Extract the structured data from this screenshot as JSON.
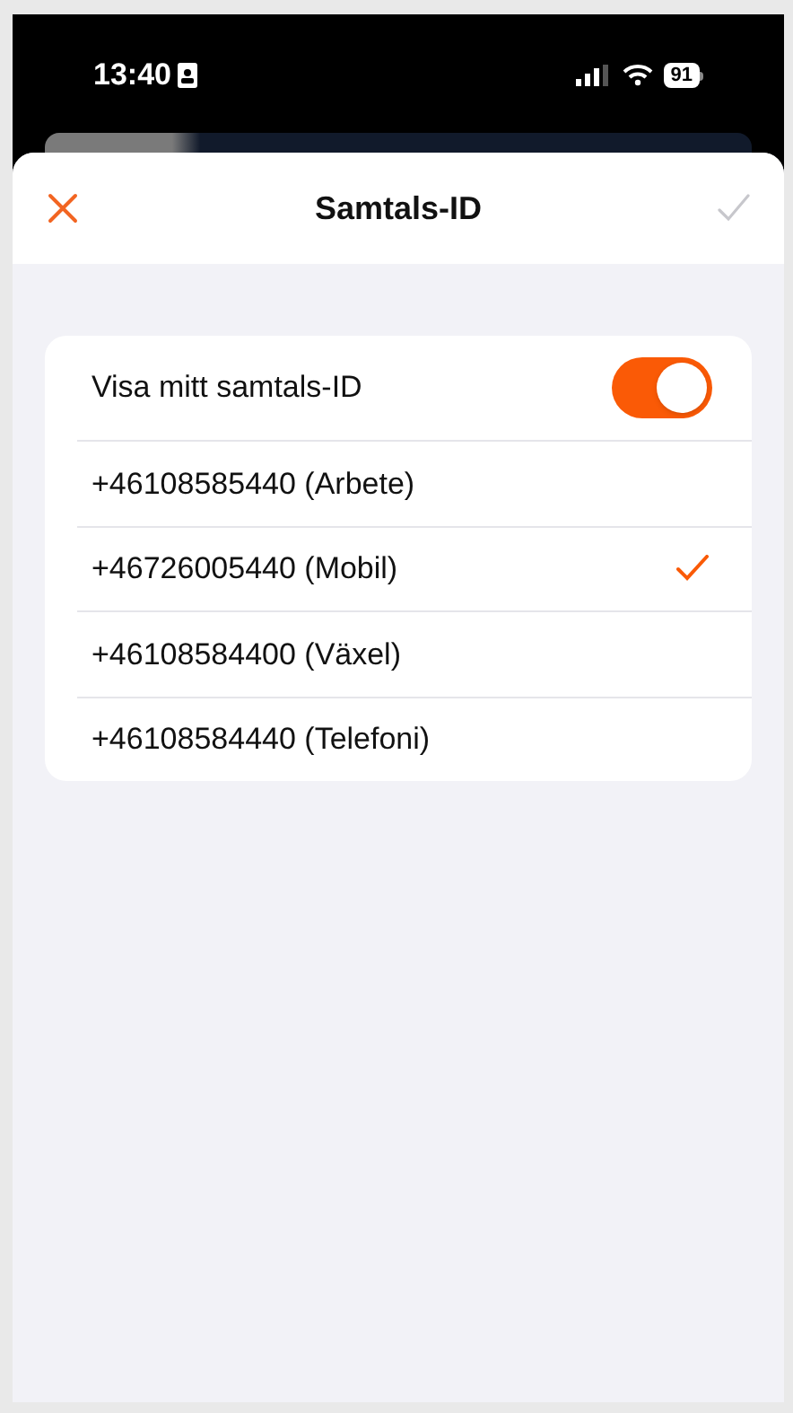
{
  "status_bar": {
    "time": "13:40",
    "battery": "91"
  },
  "header": {
    "title": "Samtals-ID"
  },
  "toggle": {
    "label": "Visa mitt samtals-ID",
    "on": true
  },
  "numbers": [
    {
      "label": "+46108585440 (Arbete)",
      "selected": false
    },
    {
      "label": "+46726005440 (Mobil)",
      "selected": true
    },
    {
      "label": "+46108584400 (Växel)",
      "selected": false
    },
    {
      "label": "+46108584440 (Telefoni)",
      "selected": false
    }
  ]
}
